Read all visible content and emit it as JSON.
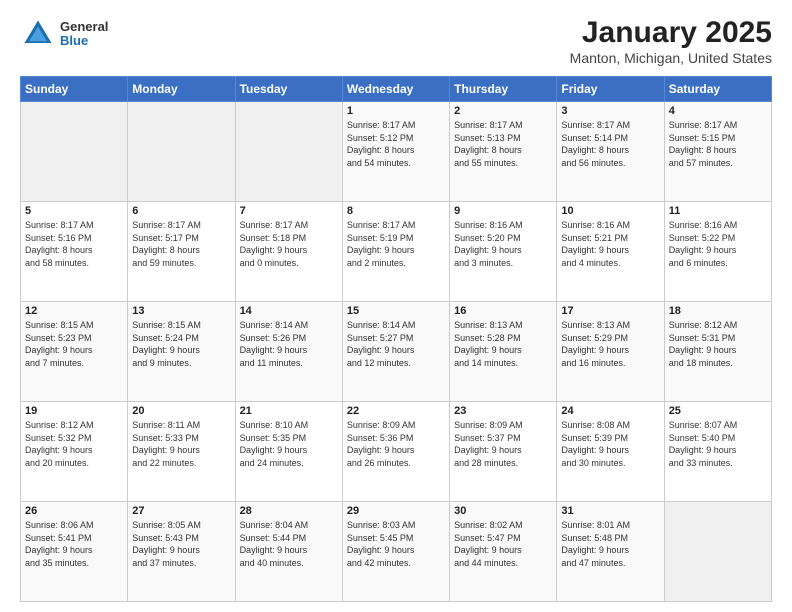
{
  "header": {
    "logo_general": "General",
    "logo_blue": "Blue",
    "title": "January 2025",
    "subtitle": "Manton, Michigan, United States"
  },
  "weekdays": [
    "Sunday",
    "Monday",
    "Tuesday",
    "Wednesday",
    "Thursday",
    "Friday",
    "Saturday"
  ],
  "weeks": [
    [
      {
        "day": "",
        "info": ""
      },
      {
        "day": "",
        "info": ""
      },
      {
        "day": "",
        "info": ""
      },
      {
        "day": "1",
        "info": "Sunrise: 8:17 AM\nSunset: 5:12 PM\nDaylight: 8 hours\nand 54 minutes."
      },
      {
        "day": "2",
        "info": "Sunrise: 8:17 AM\nSunset: 5:13 PM\nDaylight: 8 hours\nand 55 minutes."
      },
      {
        "day": "3",
        "info": "Sunrise: 8:17 AM\nSunset: 5:14 PM\nDaylight: 8 hours\nand 56 minutes."
      },
      {
        "day": "4",
        "info": "Sunrise: 8:17 AM\nSunset: 5:15 PM\nDaylight: 8 hours\nand 57 minutes."
      }
    ],
    [
      {
        "day": "5",
        "info": "Sunrise: 8:17 AM\nSunset: 5:16 PM\nDaylight: 8 hours\nand 58 minutes."
      },
      {
        "day": "6",
        "info": "Sunrise: 8:17 AM\nSunset: 5:17 PM\nDaylight: 8 hours\nand 59 minutes."
      },
      {
        "day": "7",
        "info": "Sunrise: 8:17 AM\nSunset: 5:18 PM\nDaylight: 9 hours\nand 0 minutes."
      },
      {
        "day": "8",
        "info": "Sunrise: 8:17 AM\nSunset: 5:19 PM\nDaylight: 9 hours\nand 2 minutes."
      },
      {
        "day": "9",
        "info": "Sunrise: 8:16 AM\nSunset: 5:20 PM\nDaylight: 9 hours\nand 3 minutes."
      },
      {
        "day": "10",
        "info": "Sunrise: 8:16 AM\nSunset: 5:21 PM\nDaylight: 9 hours\nand 4 minutes."
      },
      {
        "day": "11",
        "info": "Sunrise: 8:16 AM\nSunset: 5:22 PM\nDaylight: 9 hours\nand 6 minutes."
      }
    ],
    [
      {
        "day": "12",
        "info": "Sunrise: 8:15 AM\nSunset: 5:23 PM\nDaylight: 9 hours\nand 7 minutes."
      },
      {
        "day": "13",
        "info": "Sunrise: 8:15 AM\nSunset: 5:24 PM\nDaylight: 9 hours\nand 9 minutes."
      },
      {
        "day": "14",
        "info": "Sunrise: 8:14 AM\nSunset: 5:26 PM\nDaylight: 9 hours\nand 11 minutes."
      },
      {
        "day": "15",
        "info": "Sunrise: 8:14 AM\nSunset: 5:27 PM\nDaylight: 9 hours\nand 12 minutes."
      },
      {
        "day": "16",
        "info": "Sunrise: 8:13 AM\nSunset: 5:28 PM\nDaylight: 9 hours\nand 14 minutes."
      },
      {
        "day": "17",
        "info": "Sunrise: 8:13 AM\nSunset: 5:29 PM\nDaylight: 9 hours\nand 16 minutes."
      },
      {
        "day": "18",
        "info": "Sunrise: 8:12 AM\nSunset: 5:31 PM\nDaylight: 9 hours\nand 18 minutes."
      }
    ],
    [
      {
        "day": "19",
        "info": "Sunrise: 8:12 AM\nSunset: 5:32 PM\nDaylight: 9 hours\nand 20 minutes."
      },
      {
        "day": "20",
        "info": "Sunrise: 8:11 AM\nSunset: 5:33 PM\nDaylight: 9 hours\nand 22 minutes."
      },
      {
        "day": "21",
        "info": "Sunrise: 8:10 AM\nSunset: 5:35 PM\nDaylight: 9 hours\nand 24 minutes."
      },
      {
        "day": "22",
        "info": "Sunrise: 8:09 AM\nSunset: 5:36 PM\nDaylight: 9 hours\nand 26 minutes."
      },
      {
        "day": "23",
        "info": "Sunrise: 8:09 AM\nSunset: 5:37 PM\nDaylight: 9 hours\nand 28 minutes."
      },
      {
        "day": "24",
        "info": "Sunrise: 8:08 AM\nSunset: 5:39 PM\nDaylight: 9 hours\nand 30 minutes."
      },
      {
        "day": "25",
        "info": "Sunrise: 8:07 AM\nSunset: 5:40 PM\nDaylight: 9 hours\nand 33 minutes."
      }
    ],
    [
      {
        "day": "26",
        "info": "Sunrise: 8:06 AM\nSunset: 5:41 PM\nDaylight: 9 hours\nand 35 minutes."
      },
      {
        "day": "27",
        "info": "Sunrise: 8:05 AM\nSunset: 5:43 PM\nDaylight: 9 hours\nand 37 minutes."
      },
      {
        "day": "28",
        "info": "Sunrise: 8:04 AM\nSunset: 5:44 PM\nDaylight: 9 hours\nand 40 minutes."
      },
      {
        "day": "29",
        "info": "Sunrise: 8:03 AM\nSunset: 5:45 PM\nDaylight: 9 hours\nand 42 minutes."
      },
      {
        "day": "30",
        "info": "Sunrise: 8:02 AM\nSunset: 5:47 PM\nDaylight: 9 hours\nand 44 minutes."
      },
      {
        "day": "31",
        "info": "Sunrise: 8:01 AM\nSunset: 5:48 PM\nDaylight: 9 hours\nand 47 minutes."
      },
      {
        "day": "",
        "info": ""
      }
    ]
  ]
}
